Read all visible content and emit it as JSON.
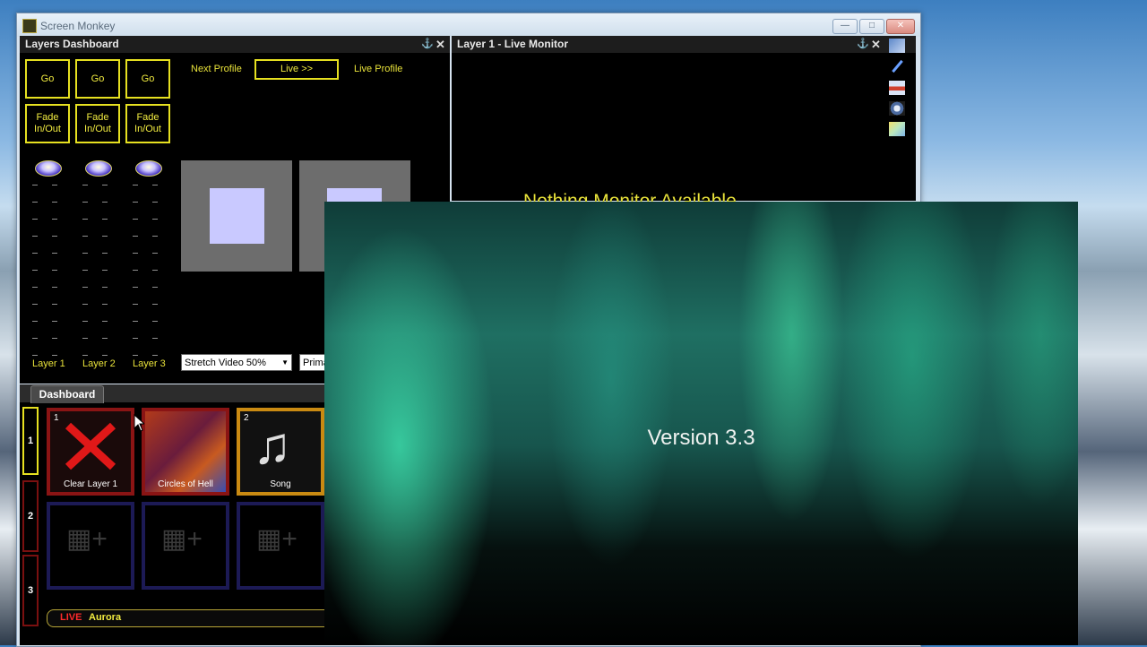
{
  "window": {
    "title": "Screen Monkey"
  },
  "layers_dashboard": {
    "title": "Layers Dashboard",
    "go_labels": [
      "Go",
      "Go",
      "Go"
    ],
    "fade_labels": [
      "Fade In/Out",
      "Fade In/Out",
      "Fade In/Out"
    ],
    "next_profile": "Next Profile",
    "live_button": "Live >>",
    "live_profile": "Live Profile",
    "layer_labels": [
      "Layer 1",
      "Layer 2",
      "Layer 3"
    ],
    "stretch_select": "Stretch Video 50%",
    "second_select": "Prima"
  },
  "live_monitor": {
    "title": "Layer 1 - Live Monitor",
    "message": "Nothing Monitor Available"
  },
  "dashboard": {
    "tab": "Dashboard",
    "rows": [
      "1",
      "2",
      "3"
    ],
    "cues": [
      {
        "num": "1",
        "label": "Clear Layer 1"
      },
      {
        "num": "",
        "label": "Circles of Hell"
      },
      {
        "num": "2",
        "label": "Song"
      }
    ],
    "live_tag": "LIVE",
    "live_name": "Aurora"
  },
  "splash": {
    "version": "Version 3.3"
  },
  "colors": {
    "accent_yellow": "#e6e020",
    "cue_red": "#8a1414",
    "cue_gold": "#c98a12",
    "cue_empty": "#1c1a55"
  }
}
